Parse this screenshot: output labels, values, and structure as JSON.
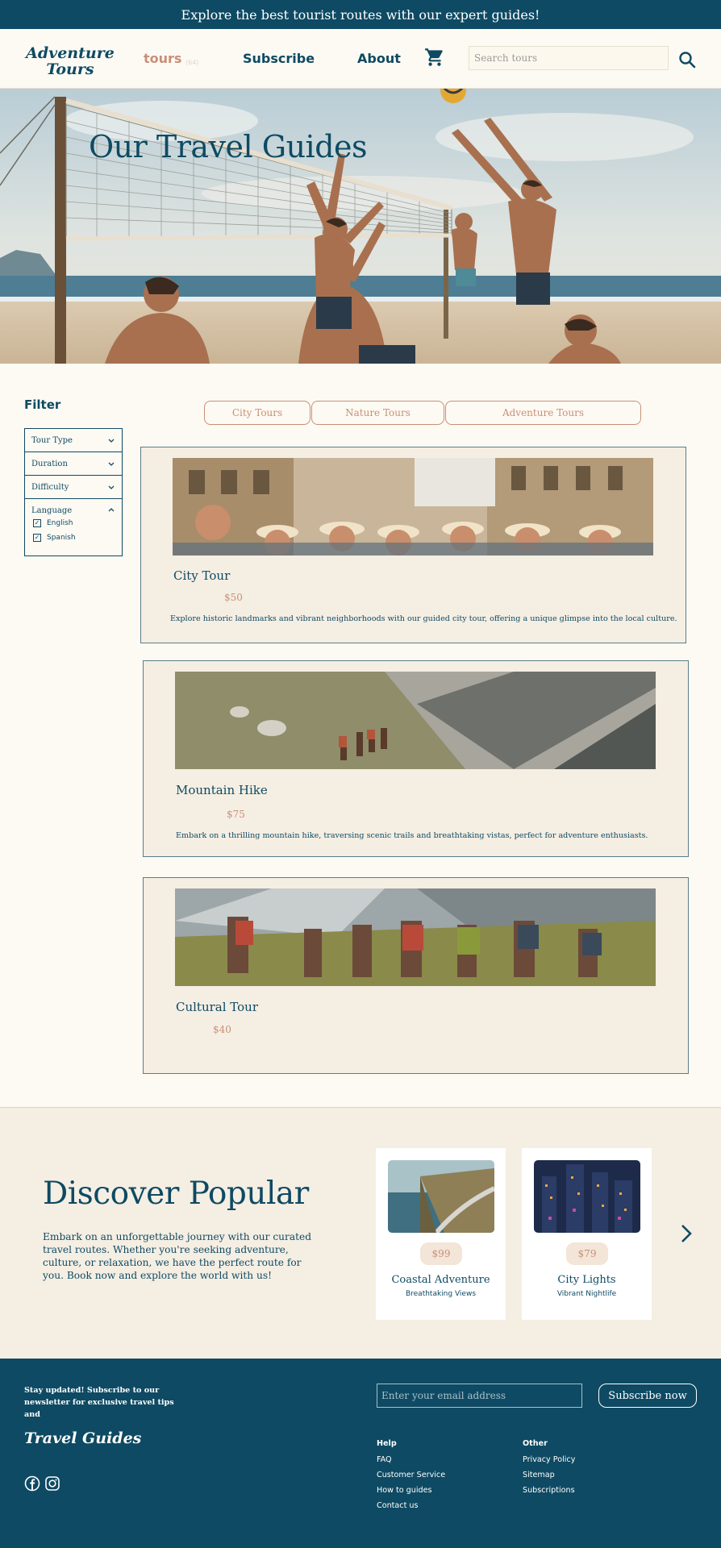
{
  "announcement": "Explore the best tourist routes with our expert guides!",
  "nav": {
    "logo": "Adventure Tours",
    "tours": "tours",
    "tours_badge": "(64)",
    "subscribe": "Subscribe",
    "about": "About",
    "search_placeholder": "Search tours"
  },
  "hero": {
    "title": "Our Travel Guides"
  },
  "filter": {
    "title": "Filter",
    "tour_type": "Tour Type",
    "duration": "Duration",
    "difficulty": "Difficulty",
    "language": "Language",
    "languages": [
      "English",
      "Spanish"
    ]
  },
  "tabs": [
    "City Tours",
    "Nature Tours",
    "Adventure Tours"
  ],
  "tours": [
    {
      "title": "City Tour",
      "price": "$50",
      "description": "Explore historic landmarks and vibrant neighborhoods with our guided city tour, offering a unique glimpse into the local culture."
    },
    {
      "title": "Mountain Hike",
      "price": "$75",
      "description": "Embark on a thrilling mountain hike, traversing scenic trails and breathtaking vistas, perfect for adventure enthusiasts."
    },
    {
      "title": "Cultural Tour",
      "price": "$40",
      "description": ""
    }
  ],
  "popular": {
    "title": "Discover Popular",
    "description": "Embark on an unforgettable journey with our curated travel routes. Whether you're seeking adventure, culture, or relaxation, we have the perfect route for you. Book now and explore the world with us!",
    "items": [
      {
        "price": "$99",
        "name": "Coastal Adventure",
        "subtitle": "Breathtaking Views"
      },
      {
        "price": "$79",
        "name": "City Lights",
        "subtitle": "Vibrant Nightlife"
      }
    ]
  },
  "footer": {
    "newsletter": "Stay updated! Subscribe to our newsletter for exclusive travel tips and",
    "email_placeholder": "Enter your email address",
    "subscribe_button": "Subscribe now",
    "logo": "Travel Guides",
    "help": {
      "heading": "Help",
      "links": [
        "FAQ",
        "Customer Service",
        "How to guides",
        "Contact us"
      ]
    },
    "other": {
      "heading": "Other",
      "links": [
        "Privacy Policy",
        "Sitemap",
        "Subscriptions"
      ]
    }
  },
  "colors": {
    "primary": "#0e4a63",
    "accent": "#c98f78",
    "background": "#fdfaf3",
    "card": "#f5eee3"
  },
  "icons": [
    "cart-icon",
    "search-icon",
    "chevron-down-icon",
    "chevron-up-icon",
    "check-icon",
    "chevron-right-icon",
    "facebook-icon",
    "instagram-icon"
  ]
}
